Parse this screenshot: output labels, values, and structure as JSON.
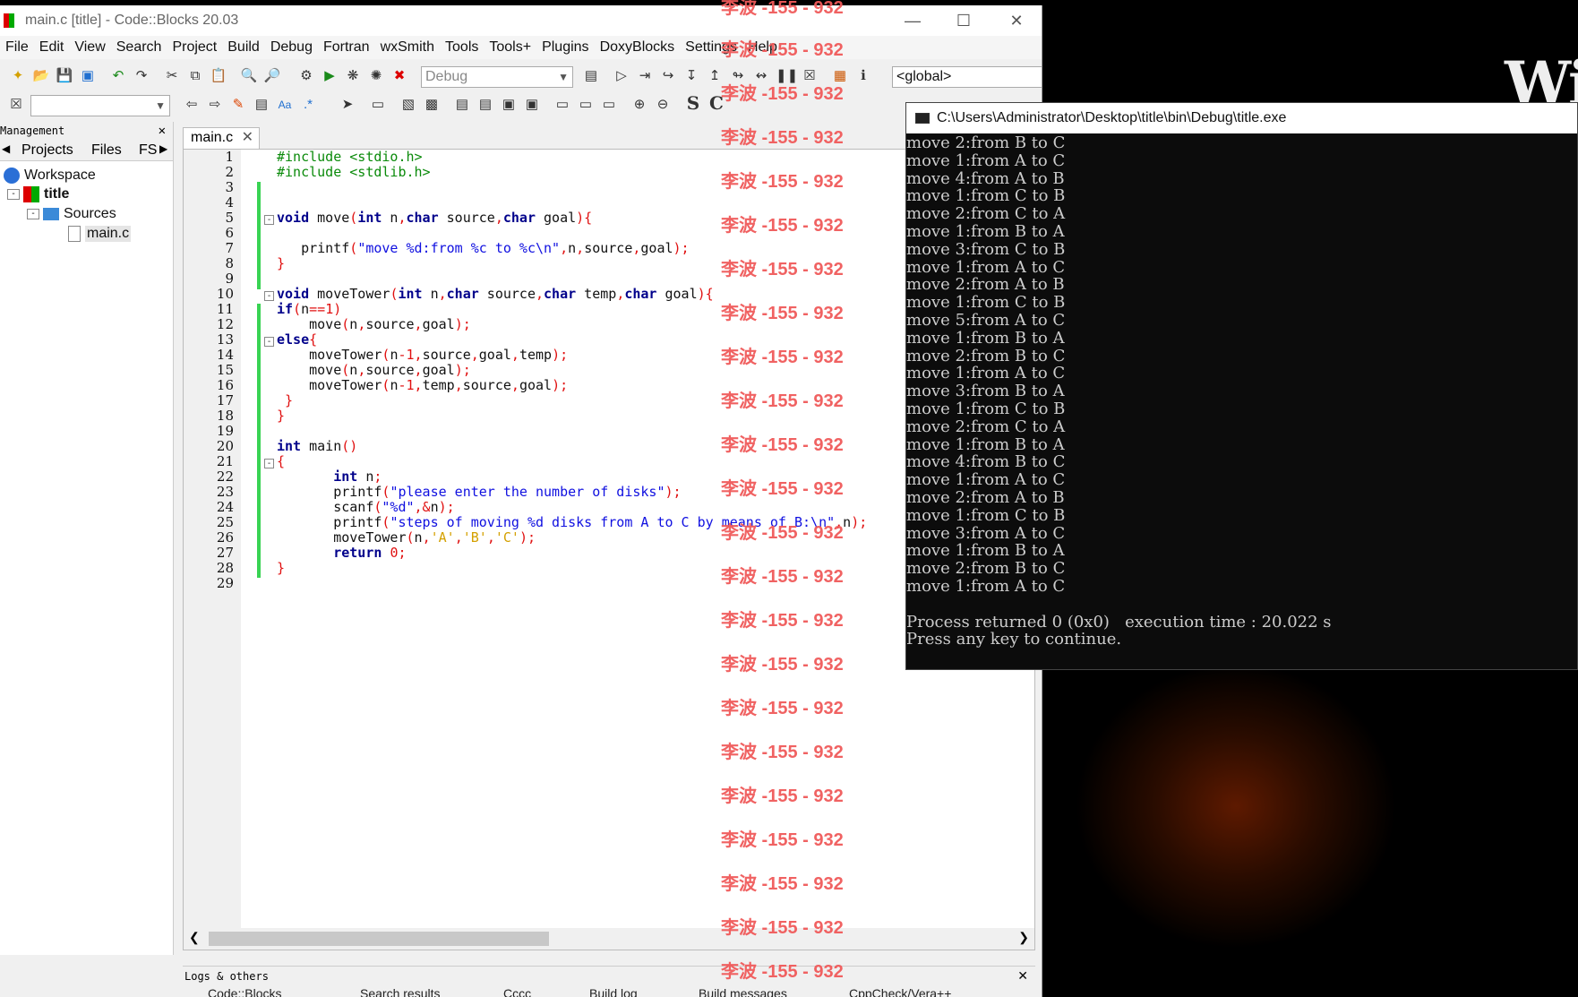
{
  "desktop": {
    "wallpaper_text": "Wi"
  },
  "codeblocks": {
    "title": "main.c [title] - Code::Blocks 20.03",
    "menu": [
      "File",
      "Edit",
      "View",
      "Search",
      "Project",
      "Build",
      "Debug",
      "Fortran",
      "wxSmith",
      "Tools",
      "Tools+",
      "Plugins",
      "DoxyBlocks",
      "Settings",
      "Help"
    ],
    "build_target": "Debug",
    "scope_combo": "<global>",
    "management": {
      "header": "Management",
      "tabs": [
        "Projects",
        "Files",
        "FS"
      ],
      "tree": {
        "workspace": "Workspace",
        "project": "title",
        "folder": "Sources",
        "file": "main.c"
      }
    },
    "editor": {
      "tab_label": "main.c",
      "line_numbers": [
        "1",
        "2",
        "3",
        "4",
        "5",
        "6",
        "7",
        "8",
        "9",
        "10",
        "11",
        "12",
        "13",
        "14",
        "15",
        "16",
        "17",
        "18",
        "19",
        "20",
        "21",
        "22",
        "23",
        "24",
        "25",
        "26",
        "27",
        "28",
        "29"
      ]
    },
    "logs": {
      "title": "Logs & others",
      "tabs": [
        "Code::Blocks",
        "Search results",
        "Cccc",
        "Build log",
        "Build messages",
        "CppCheck/Vera++"
      ]
    }
  },
  "watermark": {
    "text": "李波 -155 - 932"
  },
  "console": {
    "title": "C:\\Users\\Administrator\\Desktop\\title\\bin\\Debug\\title.exe",
    "lines": [
      "move 2:from B to C",
      "move 1:from A to C",
      "move 4:from A to B",
      "move 1:from C to B",
      "move 2:from C to A",
      "move 1:from B to A",
      "move 3:from C to B",
      "move 1:from A to C",
      "move 2:from A to B",
      "move 1:from C to B",
      "move 5:from A to C",
      "move 1:from B to A",
      "move 2:from B to C",
      "move 1:from A to C",
      "move 3:from B to A",
      "move 1:from C to B",
      "move 2:from C to A",
      "move 1:from B to A",
      "move 4:from B to C",
      "move 1:from A to C",
      "move 2:from A to B",
      "move 1:from C to B",
      "move 3:from A to C",
      "move 1:from B to A",
      "move 2:from B to C",
      "move 1:from A to C",
      "",
      "Process returned 0 (0x0)   execution time : 20.022 s",
      "Press any key to continue."
    ]
  }
}
